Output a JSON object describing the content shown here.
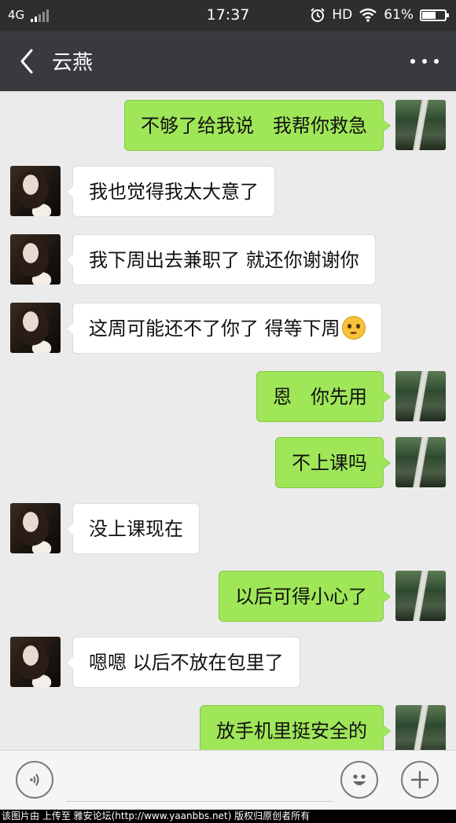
{
  "status_bar": {
    "network": "4G",
    "time": "17:37",
    "hd_label": "HD",
    "battery_text": "61%",
    "battery_level": 0.61
  },
  "header": {
    "title": "云燕"
  },
  "messages": [
    {
      "from": "me",
      "text": "不够了给我说　我帮你救急"
    },
    {
      "from": "contact",
      "text": "我也觉得我太大意了"
    },
    {
      "from": "contact",
      "text": "我下周出去兼职了 就还你谢谢你"
    },
    {
      "from": "contact",
      "text": "这周可能还不了你了 得等下周",
      "emoji": "worried-face"
    },
    {
      "from": "me",
      "text": "恩　你先用"
    },
    {
      "from": "me",
      "text": "不上课吗"
    },
    {
      "from": "contact",
      "text": "没上课现在"
    },
    {
      "from": "me",
      "text": "以后可得小心了"
    },
    {
      "from": "contact",
      "text": "嗯嗯 以后不放在包里了"
    },
    {
      "from": "me",
      "text": "放手机里挺安全的"
    }
  ],
  "input_bar": {
    "placeholder": ""
  },
  "footer": {
    "text": "该图片由 上传至 雅安论坛(http://www.yaanbbs.net) 版权归原创者所有"
  },
  "colors": {
    "header_bg": "#393a3f",
    "status_bg": "#2e2e2e",
    "chat_bg": "#ebebeb",
    "outgoing_bubble": "#9fe658",
    "incoming_bubble": "#ffffff"
  }
}
